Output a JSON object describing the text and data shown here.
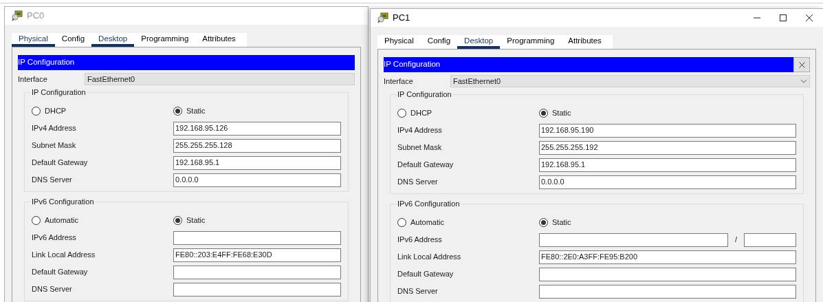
{
  "windows": [
    {
      "title": "PC0",
      "active": false,
      "window_controls": false,
      "tabs": [
        {
          "label": "Physical",
          "selected": true
        },
        {
          "label": "Config",
          "selected": false
        },
        {
          "label": "Desktop",
          "selected": true
        },
        {
          "label": "Programming",
          "selected": false
        },
        {
          "label": "Attributes",
          "selected": false
        }
      ],
      "panel": {
        "title": "IP Configuration",
        "close_button": false
      },
      "interface": {
        "label": "Interface",
        "value": "FastEthernet0",
        "dropdown": false
      },
      "ipv4": {
        "legend": "IP Configuration",
        "modes": [
          {
            "label": "DHCP",
            "selected": false
          },
          {
            "label": "Static",
            "selected": true
          }
        ],
        "fields": [
          {
            "label": "IPv4 Address",
            "value": "192.168.95.126"
          },
          {
            "label": "Subnet Mask",
            "value": "255.255.255.128"
          },
          {
            "label": "Default Gateway",
            "value": "192.168.95.1"
          },
          {
            "label": "DNS Server",
            "value": "0.0.0.0"
          }
        ]
      },
      "ipv6": {
        "legend": "IPv6 Configuration",
        "modes": [
          {
            "label": "Automatic",
            "selected": false
          },
          {
            "label": "Static",
            "selected": true
          }
        ],
        "fields": [
          {
            "label": "IPv6 Address",
            "kind": "plain"
          },
          {
            "label": "Link Local Address",
            "kind": "plain",
            "value": "FE80::203:E4FF:FE68:E30D"
          },
          {
            "label": "Default Gateway",
            "kind": "plain"
          },
          {
            "label": "DNS Server",
            "kind": "plain"
          }
        ]
      }
    },
    {
      "title": "PC1",
      "active": true,
      "window_controls": true,
      "tabs": [
        {
          "label": "Physical",
          "selected": false
        },
        {
          "label": "Config",
          "selected": false
        },
        {
          "label": "Desktop",
          "selected": true
        },
        {
          "label": "Programming",
          "selected": false
        },
        {
          "label": "Attributes",
          "selected": false
        }
      ],
      "panel": {
        "title": "IP Configuration",
        "close_button": true
      },
      "interface": {
        "label": "Interface",
        "value": "FastEthernet0",
        "dropdown": true
      },
      "ipv4": {
        "legend": "IP Configuration",
        "modes": [
          {
            "label": "DHCP",
            "selected": false
          },
          {
            "label": "Static",
            "selected": true
          }
        ],
        "fields": [
          {
            "label": "IPv4 Address",
            "value": "192.168.95.190"
          },
          {
            "label": "Subnet Mask",
            "value": "255.255.255.192"
          },
          {
            "label": "Default Gateway",
            "value": "192.168.95.1"
          },
          {
            "label": "DNS Server",
            "value": "0.0.0.0"
          }
        ]
      },
      "ipv6": {
        "legend": "IPv6 Configuration",
        "modes": [
          {
            "label": "Automatic",
            "selected": false
          },
          {
            "label": "Static",
            "selected": true
          }
        ],
        "fields": [
          {
            "label": "IPv6 Address",
            "kind": "prefixed",
            "separator": "/"
          },
          {
            "label": "Link Local Address",
            "kind": "plain",
            "value": "FE80::2E0:A3FF:FE95:B200"
          },
          {
            "label": "Default Gateway",
            "kind": "plain"
          },
          {
            "label": "DNS Server",
            "kind": "plain"
          }
        ]
      }
    }
  ]
}
